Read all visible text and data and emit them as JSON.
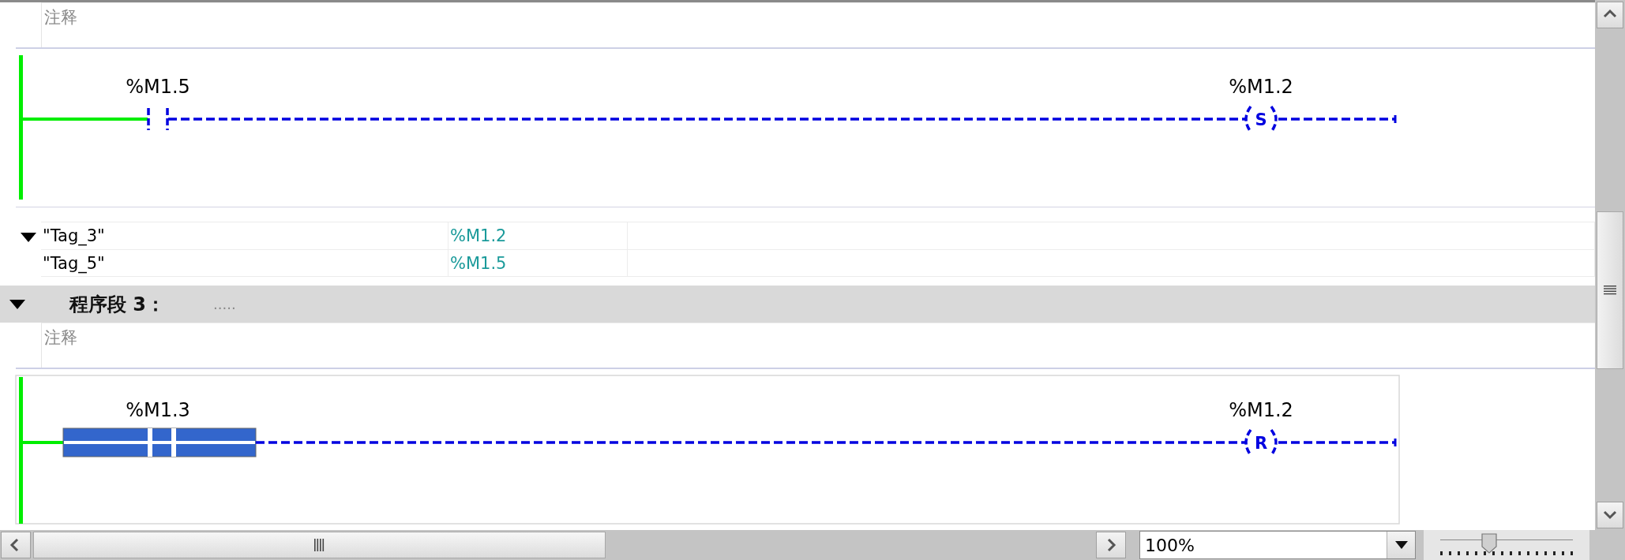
{
  "networks": [
    {
      "comment": "注释",
      "rung": {
        "contact": {
          "operand": "%M1.5",
          "selected": false
        },
        "coil": {
          "operand": "%M1.2",
          "letter": "S"
        }
      },
      "tags_expanded": true,
      "tags": [
        {
          "name": "\"Tag_3\"",
          "address": "%M1.2"
        },
        {
          "name": "\"Tag_5\"",
          "address": "%M1.5"
        }
      ]
    },
    {
      "header": {
        "title": "程序段 3：",
        "comment_dots": ".....",
        "expanded": true
      },
      "comment": "注释",
      "rung": {
        "contact": {
          "operand": "%M1.3",
          "selected": true
        },
        "coil": {
          "operand": "%M1.2",
          "letter": "R"
        }
      }
    }
  ],
  "zoom": {
    "value": "100%",
    "level": 0.37
  }
}
